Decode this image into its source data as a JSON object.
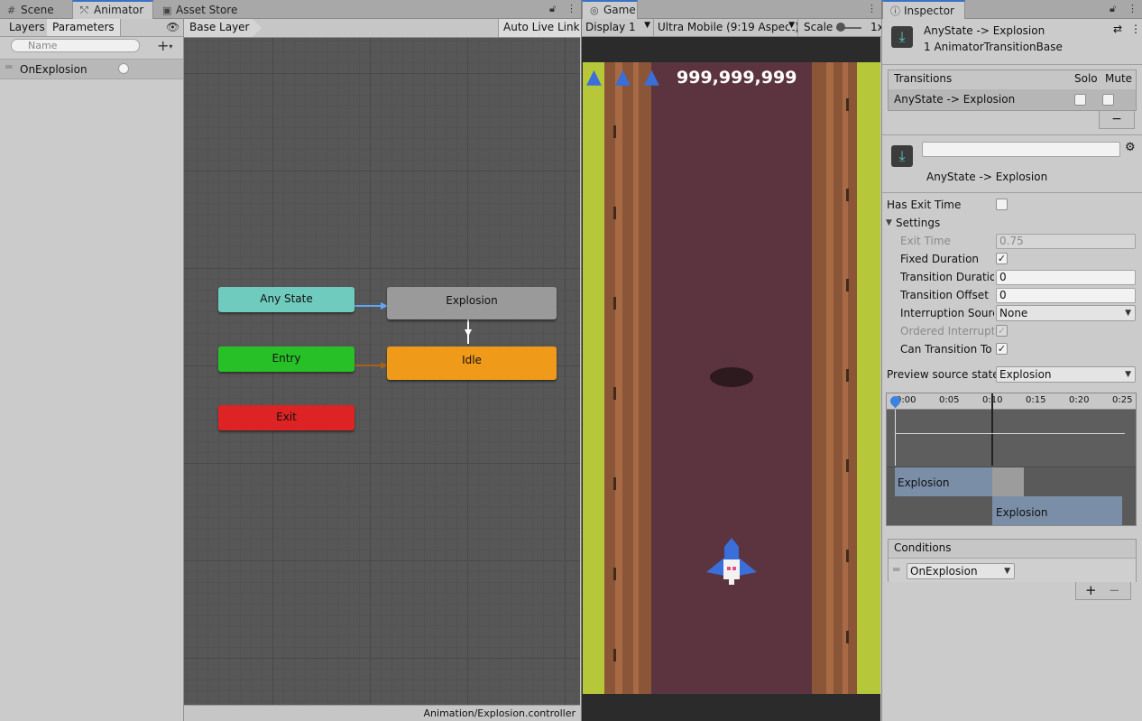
{
  "left_tabs": [
    {
      "label": "Scene",
      "icon": "grid-icon"
    },
    {
      "label": "Animator",
      "icon": "animator-icon"
    },
    {
      "label": "Asset Store",
      "icon": "store-icon"
    }
  ],
  "params": {
    "subtab_layers": "Layers",
    "subtab_parameters": "Parameters",
    "search_placeholder": "Name",
    "items": [
      {
        "name": "OnExplosion",
        "type": "trigger"
      }
    ]
  },
  "graph": {
    "breadcrumb": "Base Layer",
    "auto_live_link": "Auto Live Link",
    "status_path": "Animation/Explosion.controller",
    "nodes": {
      "any_state": "Any State",
      "explosion": "Explosion",
      "entry": "Entry",
      "idle": "Idle",
      "exit": "Exit"
    },
    "colors": {
      "any_state": "#6fcbbd",
      "explosion": "#9a9a9a",
      "entry": "#27c127",
      "idle": "#f09a1a",
      "exit": "#dd2323",
      "transition_blue": "#5ea6f2",
      "transition_orange": "#a5601a"
    }
  },
  "game": {
    "tab": "Game",
    "display": "Display 1",
    "aspect": "Ultra Mobile (9:19 Aspect)",
    "scale_label": "Scale",
    "scale_value": "1x",
    "score": "999,999,999",
    "lives": 3
  },
  "inspector": {
    "tab": "Inspector",
    "title": "AnyState -> Explosion",
    "subtitle": "1 AnimatorTransitionBase",
    "transitions_header": "Transitions",
    "solo_header": "Solo",
    "mute_header": "Mute",
    "transition_row": "AnyState -> Explosion",
    "minus": "−",
    "plus": "+",
    "name_value": "",
    "detail_title": "AnyState -> Explosion",
    "has_exit_time": "Has Exit Time",
    "settings": "Settings",
    "exit_time": "Exit Time",
    "exit_time_value": "0.75",
    "fixed_duration": "Fixed Duration",
    "transition_duration": "Transition Duratior",
    "transition_duration_value": "0",
    "transition_offset": "Transition Offset",
    "transition_offset_value": "0",
    "interruption_source": "Interruption Source",
    "interruption_source_value": "None",
    "ordered_interruption": "Ordered Interruptio",
    "can_transition_to": "Can Transition To",
    "preview_source_state": "Preview source state",
    "preview_source_value": "Explosion",
    "timeline_ticks": [
      "0:00",
      "0:05",
      "0:10",
      "0:15",
      "0:20",
      "0:25"
    ],
    "timeline_bar1": "Explosion",
    "timeline_bar2": "Explosion",
    "conditions": "Conditions",
    "condition_value": "OnExplosion"
  }
}
